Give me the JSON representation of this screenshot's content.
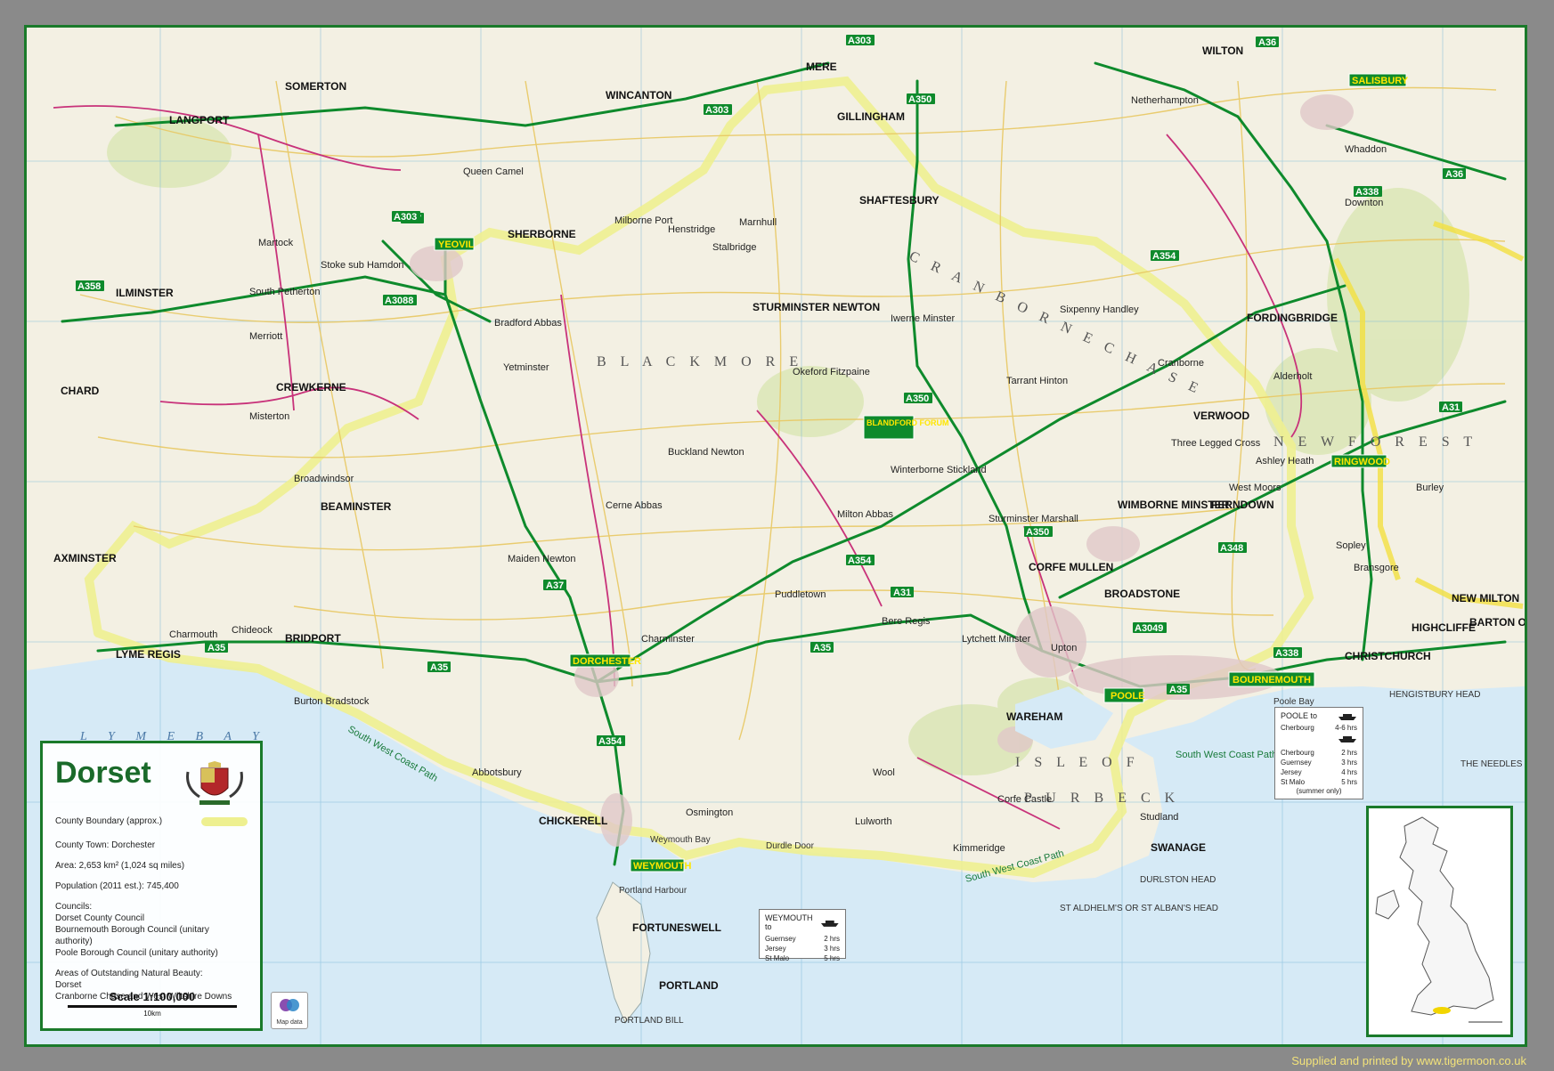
{
  "legend": {
    "title": "Dorset",
    "boundary_label": "County Boundary (approx.)",
    "county_town": "County Town: Dorchester",
    "area": "Area: 2,653 km² (1,024 sq miles)",
    "population": "Population (2011 est.): 745,400",
    "councils_heading": "Councils:",
    "councils": [
      "Dorset County Council",
      "Bournemouth Borough Council (unitary authority)",
      "Poole Borough Council (unitary authority)"
    ],
    "aonb_heading": "Areas of Outstanding Natural Beauty:",
    "aonb": [
      "Dorset",
      "Cranborne Chase and West Wiltshire Downs"
    ],
    "scale": "Scale 1:100,000",
    "scale_unit": "10km",
    "map_data": "Map data"
  },
  "ferries": {
    "poole": {
      "title": "POOLE to",
      "rows": [
        {
          "dest": "Cherbourg",
          "time": "4-6 hrs"
        },
        {
          "dest": "Cherbourg",
          "time": "2 hrs"
        },
        {
          "dest": "Guernsey",
          "time": "3 hrs"
        },
        {
          "dest": "Jersey",
          "time": "4 hrs"
        },
        {
          "dest": "St Malo",
          "time": "5 hrs"
        }
      ],
      "note": "(summer only)"
    },
    "weymouth": {
      "title": "WEYMOUTH to",
      "rows": [
        {
          "dest": "Guernsey",
          "time": "2 hrs"
        },
        {
          "dest": "Jersey",
          "time": "3 hrs"
        },
        {
          "dest": "St Malo",
          "time": "5 hrs"
        }
      ]
    }
  },
  "supplier": "Supplied and printed by www.tigermoon.co.uk",
  "sea_label": "L Y M E   B A Y",
  "towns_boxed": [
    {
      "name": "DORCHESTER"
    },
    {
      "name": "WEYMOUTH"
    },
    {
      "name": "POOLE"
    },
    {
      "name": "BOURNEMOUTH"
    },
    {
      "name": "BLANDFORD FORUM"
    },
    {
      "name": "YEOVIL"
    },
    {
      "name": "SALISBURY"
    },
    {
      "name": "RINGWOOD"
    }
  ],
  "roads": [
    "A35",
    "A37",
    "A303",
    "A350",
    "A354",
    "A338",
    "A31",
    "A36",
    "A3049",
    "A348",
    "A358",
    "A3088"
  ],
  "towns": [
    "SHERBORNE",
    "GILLINGHAM",
    "SHAFTESBURY",
    "STURMINSTER NEWTON",
    "WIMBORNE MINSTER",
    "FERNDOWN",
    "CHRISTCHURCH",
    "WAREHAM",
    "SWANAGE",
    "BRIDPORT",
    "BEAMINSTER",
    "LYME REGIS",
    "CREWKERNE",
    "CHARD",
    "AXMINSTER",
    "WINCANTON",
    "FORDINGBRIDGE",
    "VERWOOD",
    "PORTLAND",
    "FORTUNESWELL",
    "CHICKERELL",
    "WILTON",
    "LANGPORT",
    "SOMERTON",
    "ILMINSTER",
    "MERE",
    "NEW MILTON",
    "BROADSTONE",
    "CORFE MULLEN",
    "HIGHCLIFFE",
    "BARTON ON SEA"
  ],
  "villages": [
    "Stalbridge",
    "Marnhull",
    "Milborne Port",
    "Bradford Abbas",
    "Yetminster",
    "Cerne Abbas",
    "Puddletown",
    "Bere Regis",
    "Charminster",
    "Maiden Newton",
    "Broadwindsor",
    "Buckland Newton",
    "Milton Abbas",
    "Winterborne Stickland",
    "Okeford Fitzpaine",
    "Iwerne Minster",
    "Tarrant Hinton",
    "Cranborne",
    "Alderholt",
    "West Moors",
    "Three Legged Cross",
    "Sixpenny Handley",
    "Wool",
    "Corfe Castle",
    "Studland",
    "Kimmeridge",
    "Lulworth",
    "Osmington",
    "Abbotsbury",
    "Burton Bradstock",
    "Charmouth",
    "Chideock",
    "Upton",
    "Lytchett Minster",
    "Sturminster Marshall",
    "Ashley Heath",
    "Bransgore",
    "Sopley",
    "Burley",
    "Downton",
    "Whaddon",
    "Netherhampton",
    "Stoke sub Hamdon",
    "Martock",
    "South Petherton",
    "Merriott",
    "Misterton",
    "Queen Camel",
    "Henstridge"
  ],
  "area_labels": [
    "B L A C K M O R E",
    "I S L E   O F",
    "P U R B E C K",
    "N E W   F O R E S T",
    "C R A N B O R N E   C H A S E"
  ],
  "coast_labels": [
    "South West Coast Path",
    "South West Coast Path",
    "South West Coast Path"
  ],
  "headlands": [
    "PORTLAND BILL",
    "DURLSTON HEAD",
    "ST ALDHELM'S OR ST ALBAN'S HEAD",
    "HENGISTBURY HEAD",
    "THE NEEDLES",
    "Durdle Door",
    "Portland Harbour",
    "Poole Bay",
    "Weymouth Bay"
  ]
}
